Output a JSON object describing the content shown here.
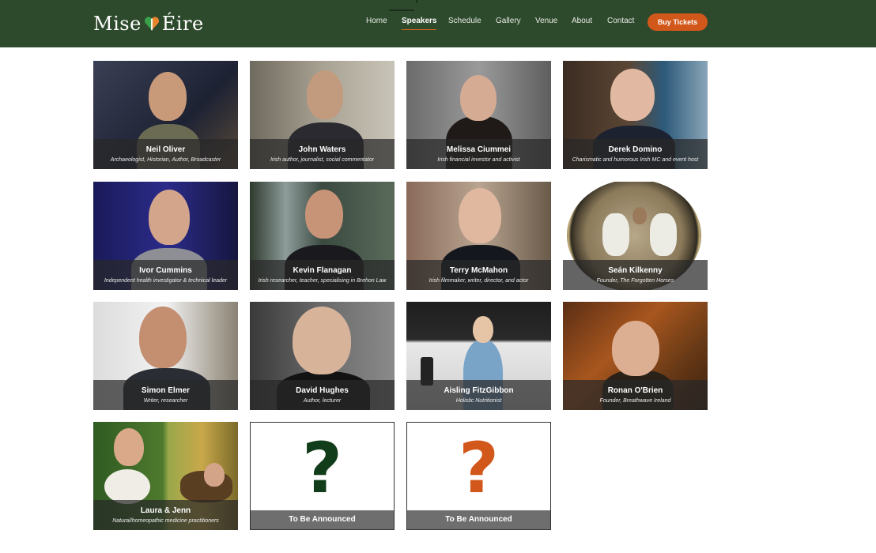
{
  "brand": {
    "logo_left": "Mise",
    "logo_right": "Éire",
    "colors": {
      "header": "#2e4a2c",
      "accent": "#d2571a",
      "tba_dark": "#123d1a",
      "tba_orange": "#d2571a"
    }
  },
  "nav": {
    "items": [
      {
        "label": "Home"
      },
      {
        "label": "Speakers"
      },
      {
        "label": "Schedule"
      },
      {
        "label": "Gallery"
      },
      {
        "label": "Venue"
      },
      {
        "label": "About"
      },
      {
        "label": "Contact"
      }
    ],
    "active": "Speakers",
    "cta": "Buy Tickets"
  },
  "speakers": [
    {
      "name": "Neil Oliver",
      "role": "Archaeologist, Historian, Author, Broadcaster"
    },
    {
      "name": "John Waters",
      "role": "Irish author, journalist, social commentator"
    },
    {
      "name": "Melissa Ciummei",
      "role": "Irish financial investor and activist"
    },
    {
      "name": "Derek Domino",
      "role": "Charismatic and humorous Irish MC and event host"
    },
    {
      "name": "Ivor Cummins",
      "role": "Independent health investigator & technical leader"
    },
    {
      "name": "Kevin Flanagan",
      "role": "Irish researcher, teacher, specialising in Brehon Law"
    },
    {
      "name": "Terry McMahon",
      "role": "Irish filmmaker, writer, director, and actor"
    },
    {
      "name": "Seán Kilkenny",
      "role": "Founder, The Forgotten Horses"
    },
    {
      "name": "Simon Elmer",
      "role": "Writer, researcher"
    },
    {
      "name": "David Hughes",
      "role": "Author, lecturer"
    },
    {
      "name": "Aisling FitzGibbon",
      "role": "Holistic Nutritionist"
    },
    {
      "name": "Ronan O'Brien",
      "role": "Founder, Breathwave Ireland"
    },
    {
      "name": "Laura & Jenn",
      "role": "Natural/homeopathic medicine practitioners"
    }
  ],
  "tba": [
    {
      "label": "To Be Announced",
      "mark": "?"
    },
    {
      "label": "To Be Announced",
      "mark": "?"
    }
  ]
}
